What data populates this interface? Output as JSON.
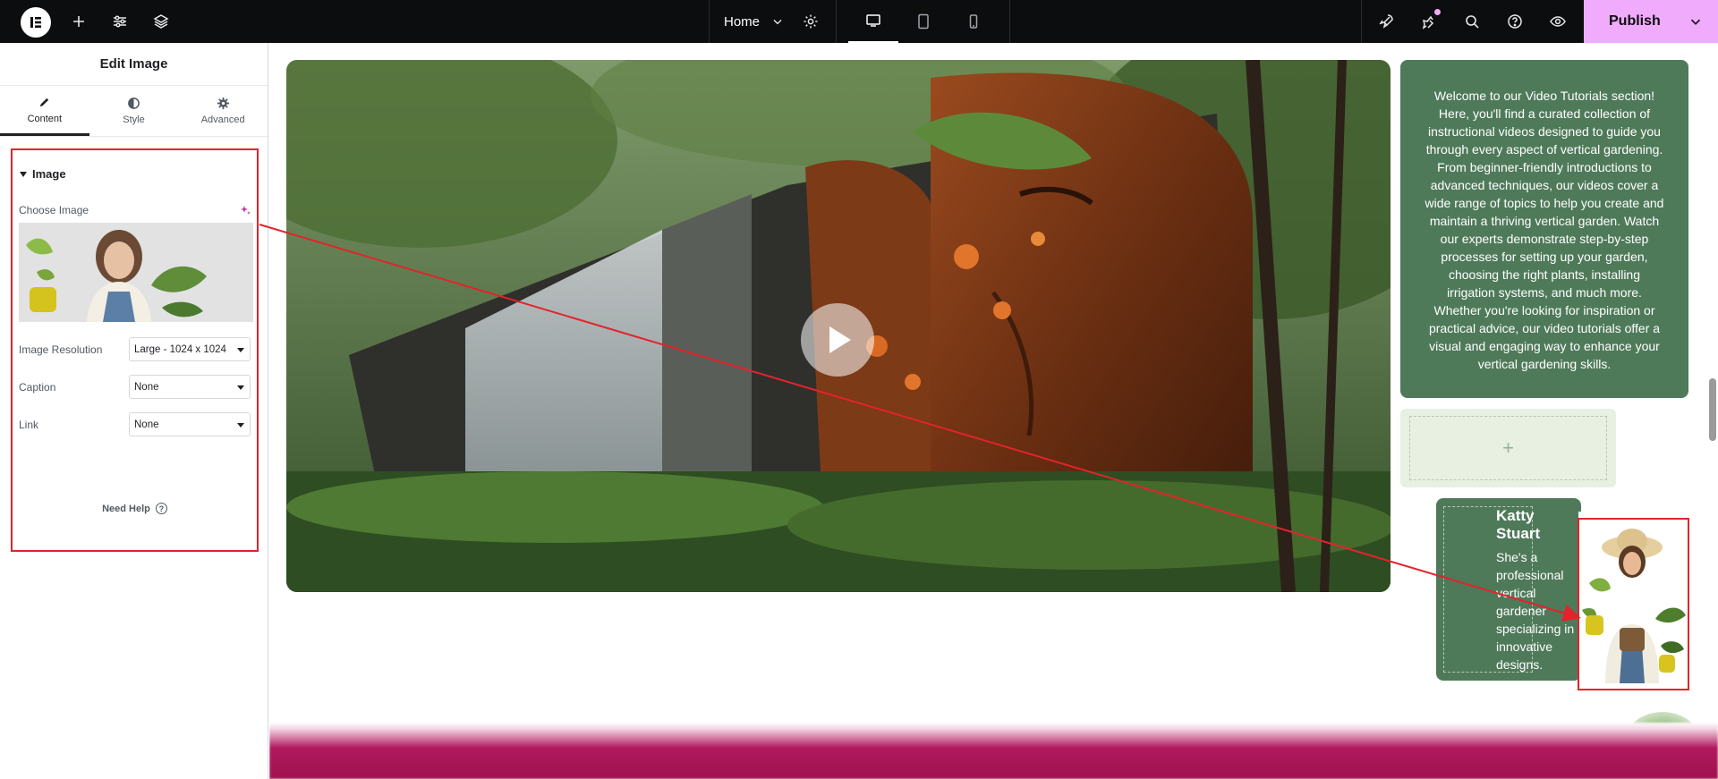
{
  "topbar": {
    "page_name": "Home",
    "publish_label": "Publish",
    "icons": [
      "elementor-logo-icon",
      "add-icon",
      "settings-sliders-icon",
      "layers-icon",
      "page-settings-gear-icon",
      "desktop-icon",
      "tablet-icon",
      "mobile-icon",
      "launchpad-icon",
      "notifications-icon",
      "search-icon",
      "help-icon",
      "preview-eye-icon",
      "chevron-down-icon"
    ],
    "accent": "#f0abfc"
  },
  "panel": {
    "title": "Edit Image",
    "tabs": [
      {
        "label": "Content",
        "icon": "pencil-icon",
        "active": true
      },
      {
        "label": "Style",
        "icon": "contrast-icon",
        "active": false
      },
      {
        "label": "Advanced",
        "icon": "gear-icon",
        "active": false
      }
    ],
    "section_title": "Image",
    "choose_image_label": "Choose Image",
    "resolution_label": "Image Resolution",
    "resolution_value": "Large - 1024 x 1024",
    "caption_label": "Caption",
    "caption_value": "None",
    "link_label": "Link",
    "link_value": "None",
    "need_help": "Need Help",
    "help_glyph": "?"
  },
  "canvas": {
    "video_play_icon": "play-icon",
    "info_text": "Welcome to our Video Tutorials section! Here, you'll find a curated collection of instructional videos designed to guide you through every aspect of vertical gardening. From beginner-friendly introductions to advanced techniques, our videos cover a wide range of topics to help you create and maintain a thriving vertical garden. Watch our experts demonstrate step-by-step processes for setting up your garden, choosing the right plants, installing irrigation systems, and much more. Whether you're looking for inspiration or practical advice, our video tutorials offer a visual and engaging way to enhance your vertical gardening skills.",
    "empty_column_plus": "+",
    "profile_name": "Katty Stuart",
    "profile_bio": "She's a professional vertical gardener specializing in innovative designs.",
    "card_color": "#4f7a5a",
    "highlight_color": "#e3232b"
  }
}
